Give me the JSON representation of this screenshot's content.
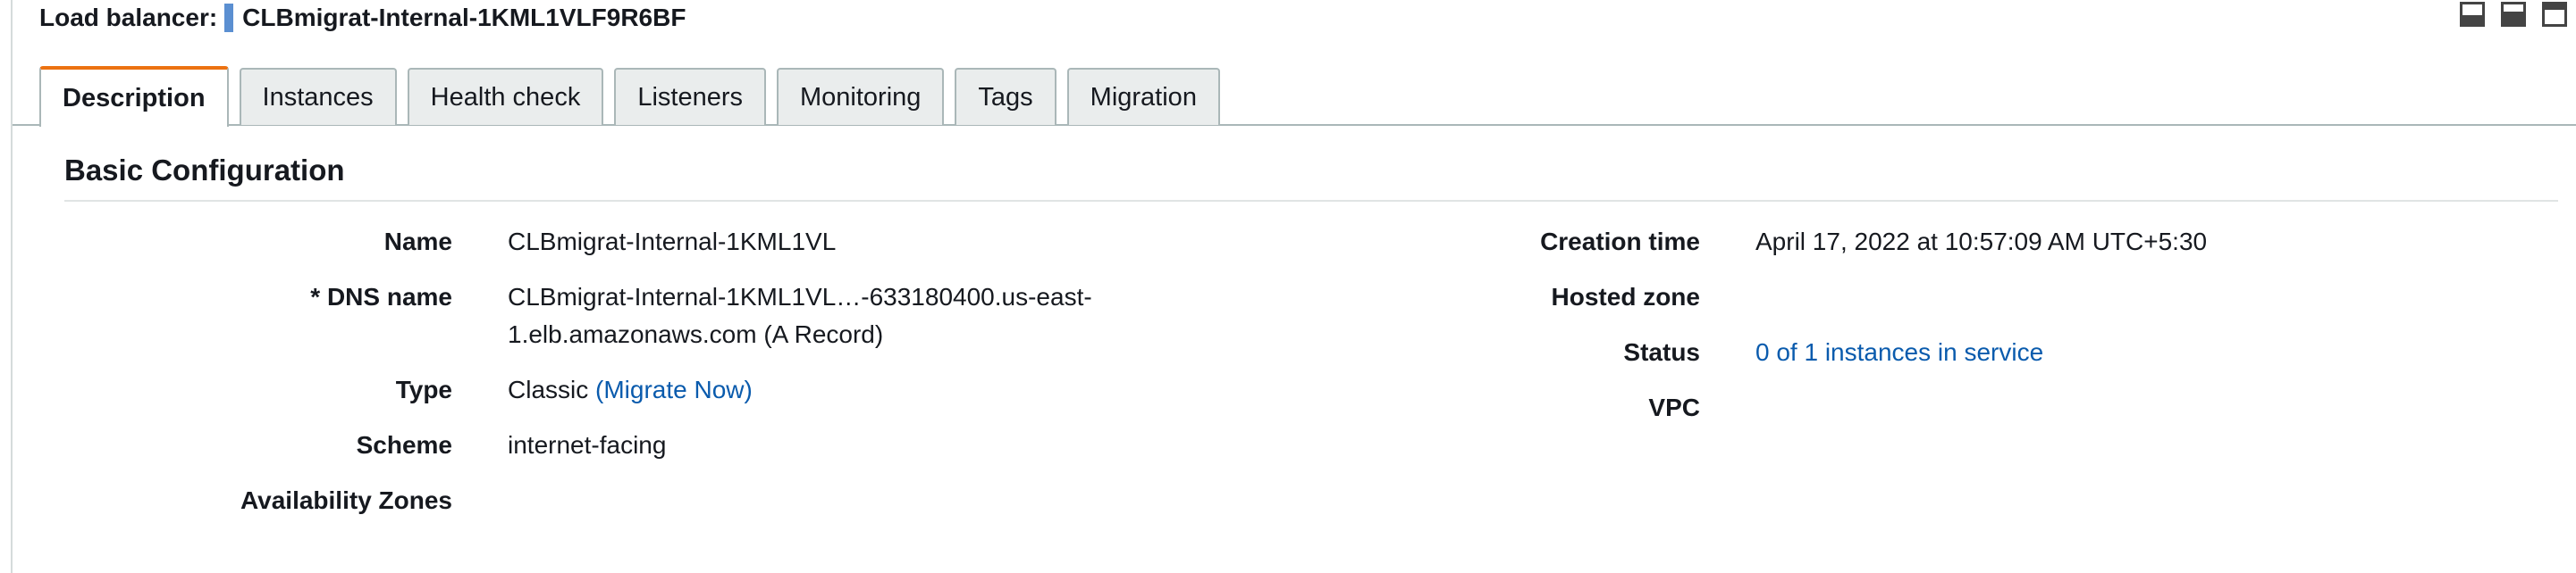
{
  "header": {
    "label": "Load balancer:",
    "name": "CLBmigrat-Internal-1KML1VLF9R6BF"
  },
  "pane_icons": [
    "pane-bottom-icon",
    "pane-split-icon",
    "pane-top-icon"
  ],
  "tabs": [
    {
      "label": "Description",
      "active": true
    },
    {
      "label": "Instances"
    },
    {
      "label": "Health check"
    },
    {
      "label": "Listeners"
    },
    {
      "label": "Monitoring"
    },
    {
      "label": "Tags"
    },
    {
      "label": "Migration"
    }
  ],
  "section": {
    "title": "Basic Configuration"
  },
  "left": {
    "name_key": "Name",
    "name_val": "CLBmigrat-Internal-1KML1VL",
    "dns_key": "* DNS name",
    "dns_val": "CLBmigrat-Internal-1KML1VL…-633180400.us-east-1.elb.amazonaws.com (A Record)",
    "type_key": "Type",
    "type_val": "Classic",
    "type_link": "(Migrate Now)",
    "scheme_key": "Scheme",
    "scheme_val": "internet-facing",
    "az_key": "Availability Zones",
    "az_val": ""
  },
  "right": {
    "creation_key": "Creation time",
    "creation_val": "April 17, 2022 at 10:57:09 AM UTC+5:30",
    "hosted_key": "Hosted zone",
    "hosted_val": "",
    "status_key": "Status",
    "status_val": "0 of 1 instances in service",
    "vpc_key": "VPC",
    "vpc_val": ""
  },
  "colors": {
    "accent_tab": "#ec7211",
    "link": "#0a5bad",
    "header_marker": "#5b8fd1"
  }
}
